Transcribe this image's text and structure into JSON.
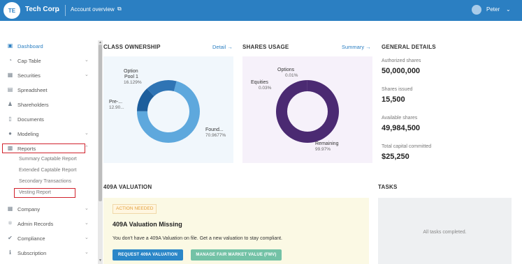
{
  "topbar": {
    "avatar_initials": "TE",
    "company": "Tech Corp",
    "account_overview": "Account overview",
    "user_name": "Peter",
    "brand_color": "#2b7fc2"
  },
  "sidebar": {
    "items": [
      {
        "label": "Dashboard",
        "icon": "dashboard-icon",
        "active": true
      },
      {
        "label": "Cap Table",
        "icon": "pie-icon",
        "has_chevron": true
      },
      {
        "label": "Securities",
        "icon": "securities-icon",
        "has_chevron": true
      },
      {
        "label": "Spreadsheet",
        "icon": "spreadsheet-icon"
      },
      {
        "label": "Shareholders",
        "icon": "shareholders-icon"
      },
      {
        "label": "Documents",
        "icon": "documents-icon"
      },
      {
        "label": "Modeling",
        "icon": "bulb-icon",
        "has_chevron": true
      },
      {
        "label": "Reports",
        "icon": "reports-icon",
        "expanded": true
      },
      {
        "label": "Company",
        "icon": "company-icon",
        "has_chevron": true
      },
      {
        "label": "Admin Records",
        "icon": "admin-icon",
        "has_chevron": true
      },
      {
        "label": "Compliance",
        "icon": "compliance-icon",
        "has_chevron": true
      },
      {
        "label": "Subscription",
        "icon": "subscription-icon",
        "has_chevron": true
      }
    ],
    "report_subitems": [
      "Summary Captable Report",
      "Extended Captable Report",
      "Secondary Transactions",
      "Vesting Report"
    ]
  },
  "class_ownership": {
    "title": "CLASS OWNERSHIP",
    "link": "Detail",
    "labels": {
      "option_pool": "Option Pool 1",
      "option_pool_line1": "Option",
      "option_pool_line2": "Pool 1",
      "option_pool_value": "16.129%",
      "pre": "Pre-...",
      "pre_value": "12.90...",
      "found": "Found...",
      "found_value": "70.9677%"
    }
  },
  "shares_usage": {
    "title": "SHARES USAGE",
    "link": "Summary",
    "labels": {
      "options": "Options",
      "options_value": "0.01%",
      "equities": "Equities",
      "equities_value": "0.03%",
      "remaining": "Remaining",
      "remaining_value": "99.97%"
    }
  },
  "chart_data": [
    {
      "type": "pie",
      "title": "CLASS OWNERSHIP",
      "categories": [
        "Found...",
        "Pre-...",
        "Option Pool 1"
      ],
      "values": [
        70.9677,
        12.9,
        16.129
      ],
      "colors": [
        "#5ea8dd",
        "#1d5e9c",
        "#2f74b4"
      ]
    },
    {
      "type": "pie",
      "title": "SHARES USAGE",
      "categories": [
        "Remaining",
        "Equities",
        "Options"
      ],
      "values": [
        99.97,
        0.03,
        0.01
      ],
      "colors": [
        "#4b2a72",
        "#4b2a72",
        "#4b2a72"
      ]
    }
  ],
  "general_details": {
    "title": "GENERAL DETAILS",
    "rows": [
      {
        "label": "Authorized shares",
        "value": "50,000,000"
      },
      {
        "label": "Shares issued",
        "value": "15,500"
      },
      {
        "label": "Available shares",
        "value": "49,984,500"
      },
      {
        "label": "Total capital committed",
        "value": "$25,250"
      }
    ]
  },
  "valuation": {
    "title": "409A VALUATION",
    "badge": "ACTION NEEDED",
    "heading": "409A Valuation Missing",
    "text": "You don't have a 409A Valuation on file. Get a new valuation to stay compliant.",
    "primary_button": "REQUEST 409A VALUATION",
    "secondary_button": "MANAGE FAIR MARKET VALUE (FMV)"
  },
  "tasks": {
    "title": "TASKS",
    "empty_text": "All tasks completed."
  }
}
